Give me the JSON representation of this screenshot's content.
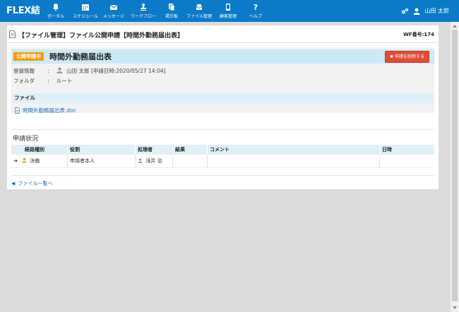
{
  "app": {
    "brand": "FLEX結"
  },
  "nav": [
    {
      "label": "ポータル",
      "icon": "bell-icon"
    },
    {
      "label": "スケジュール",
      "icon": "calendar-icon"
    },
    {
      "label": "メッセージ",
      "icon": "envelope-icon"
    },
    {
      "label": "ワークフロー",
      "icon": "stamp-icon"
    },
    {
      "label": "掲示板",
      "icon": "board-icon"
    },
    {
      "label": "ファイル管理",
      "icon": "inbox-icon"
    },
    {
      "label": "顧客管理",
      "icon": "phone-icon"
    },
    {
      "label": "ヘルプ",
      "icon": "help-icon"
    }
  ],
  "user": {
    "name": "山田 太郎"
  },
  "page": {
    "title": "【ファイル管理】ファイル公開申請【時間外勤務届出表】",
    "wf_number": "WF番号:174"
  },
  "request": {
    "status_badge": "公開申請中",
    "title": "時間外勤務届出表",
    "cancel_label": "申請を削除する",
    "registration_label": "登録情報",
    "registration_value": "山田 太郎 [申請日時:2020/05/27 14:04]",
    "folder_label": "フォルダ",
    "folder_value": "ルート",
    "colon": ":"
  },
  "files": {
    "header": "ファイル",
    "items": [
      "時間外勤務届出表.doc"
    ]
  },
  "approval": {
    "title": "申請状況",
    "columns": [
      "経路種別",
      "役割",
      "処理者",
      "結果",
      "コメント",
      "日時"
    ],
    "rows": [
      {
        "route_type": "決裁",
        "role": "申請者本人",
        "processor": "浅井 治",
        "result": "",
        "comment": "",
        "datetime": ""
      }
    ]
  },
  "back_link": "ファイル一覧へ",
  "colors": {
    "header": "#0b7ac9",
    "badge": "#f39c12",
    "danger": "#e24c35",
    "link": "#1a6fbf"
  }
}
